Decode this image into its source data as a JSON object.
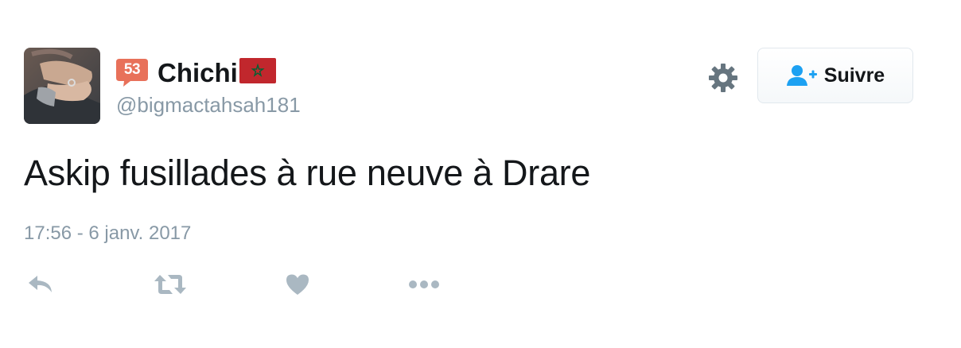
{
  "user": {
    "display_name": "Chichi",
    "handle": "@bigmactahsah181",
    "badge_number": "53",
    "flag_country": "Morocco"
  },
  "follow_button": {
    "label": "Suivre",
    "icon": "user-plus-icon"
  },
  "settings_icon": "gear-icon",
  "tweet": {
    "text": "Askip fusillades à rue neuve à Drare",
    "timestamp": "17:56 - 6 janv. 2017"
  },
  "actions": [
    {
      "icon": "reply-icon"
    },
    {
      "icon": "retweet-icon"
    },
    {
      "icon": "like-icon"
    },
    {
      "icon": "more-icon"
    }
  ],
  "colors": {
    "text_primary": "#14171a",
    "text_secondary": "#8899a6",
    "accent_blue": "#1da1f2",
    "icon_gray": "#aab8c2",
    "badge_orange": "#e8715a",
    "flag_red": "#c1272d",
    "flag_green": "#006233"
  }
}
